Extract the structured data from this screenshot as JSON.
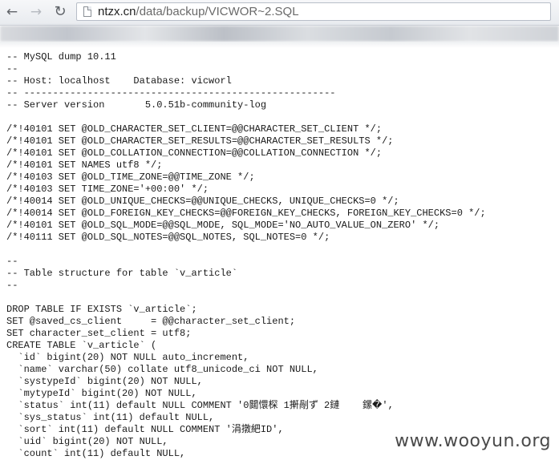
{
  "browser": {
    "url_host": "ntzx.cn",
    "url_path": "/data/backup/VICWOR~2.SQL",
    "back_icon": "←",
    "forward_icon": "→",
    "reload_icon": "↻"
  },
  "document": {
    "lines": [
      "-- MySQL dump 10.11",
      "--",
      "-- Host: localhost    Database: vicworl",
      "-- ------------------------------------------------------",
      "-- Server version       5.0.51b-community-log",
      "",
      "/*!40101 SET @OLD_CHARACTER_SET_CLIENT=@@CHARACTER_SET_CLIENT */;",
      "/*!40101 SET @OLD_CHARACTER_SET_RESULTS=@@CHARACTER_SET_RESULTS */;",
      "/*!40101 SET @OLD_COLLATION_CONNECTION=@@COLLATION_CONNECTION */;",
      "/*!40101 SET NAMES utf8 */;",
      "/*!40103 SET @OLD_TIME_ZONE=@@TIME_ZONE */;",
      "/*!40103 SET TIME_ZONE='+00:00' */;",
      "/*!40014 SET @OLD_UNIQUE_CHECKS=@@UNIQUE_CHECKS, UNIQUE_CHECKS=0 */;",
      "/*!40014 SET @OLD_FOREIGN_KEY_CHECKS=@@FOREIGN_KEY_CHECKS, FOREIGN_KEY_CHECKS=0 */;",
      "/*!40101 SET @OLD_SQL_MODE=@@SQL_MODE, SQL_MODE='NO_AUTO_VALUE_ON_ZERO' */;",
      "/*!40111 SET @OLD_SQL_NOTES=@@SQL_NOTES, SQL_NOTES=0 */;",
      "",
      "--",
      "-- Table structure for table `v_article`",
      "--",
      "",
      "DROP TABLE IF EXISTS `v_article`;",
      "SET @saved_cs_client     = @@character_set_client;",
      "SET character_set_client = utf8;",
      "CREATE TABLE `v_article` (",
      "  `id` bigint(20) NOT NULL auto_increment,",
      "  `name` varchar(50) collate utf8_unicode_ci NOT NULL,",
      "  `systypeId` bigint(20) NOT NULL,",
      "  `mytypeId` bigint(20) NOT NULL,",
      "  `status` int(11) default NULL COMMENT '0閮懁棎 1搟剮ず 2鏈    鏍�',",
      "  `sys_status` int(11) default NULL,",
      "  `sort` int(11) default NULL COMMENT '涓撴紦ID',",
      "  `uid` bigint(20) NOT NULL,",
      "  `count` int(11) default NULL,"
    ]
  },
  "watermark": "www.wooyun.org"
}
